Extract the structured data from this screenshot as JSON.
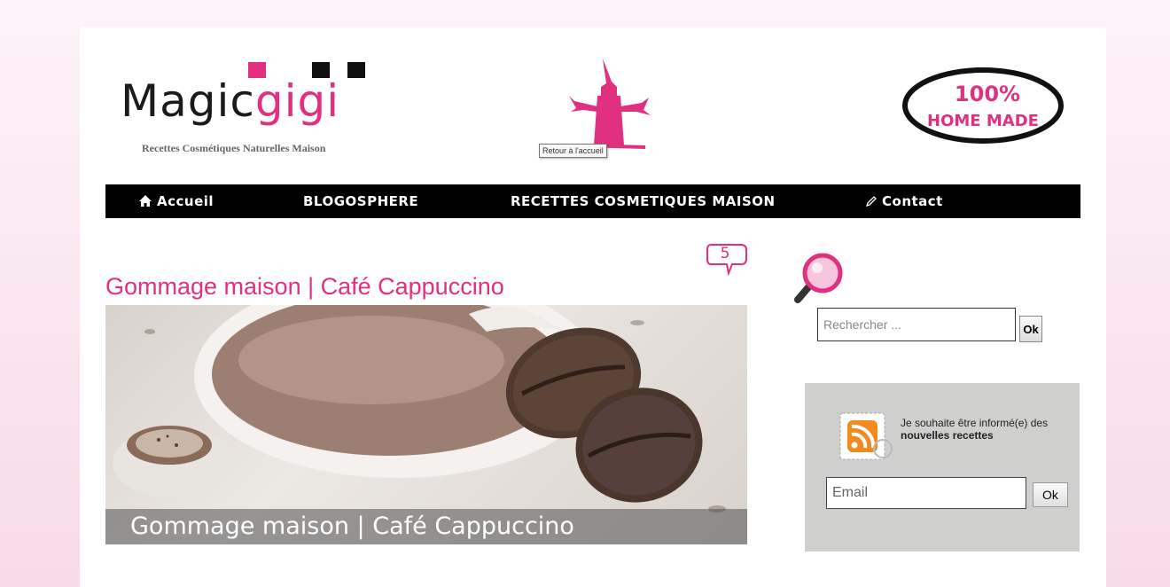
{
  "header": {
    "logo": {
      "part1": "Magic",
      "part2": "gigi",
      "tagline": "Recettes Cosmétiques Naturelles Maison"
    },
    "home_tooltip": "Retour à l'accueil",
    "badge": {
      "line1": "100%",
      "line2": "HOME MADE"
    }
  },
  "nav": {
    "items": [
      {
        "label": "Accueil",
        "icon": "home-icon"
      },
      {
        "label": "BLOGOSPHERE"
      },
      {
        "label": "RECETTES COSMETIQUES MAISON"
      },
      {
        "label": "Contact",
        "icon": "pencil-icon"
      }
    ]
  },
  "article": {
    "comment_count": "5",
    "title": "Gommage maison | Café Cappuccino",
    "image_caption": "Gommage maison | Café Cappuccino"
  },
  "sidebar": {
    "search": {
      "placeholder": "Rechercher ...",
      "button": "Ok"
    },
    "newsletter": {
      "text_plain": "Je souhaite être informé(e) des",
      "text_bold": "nouvelles recettes",
      "email_placeholder": "Email",
      "button": "Ok"
    }
  },
  "colors": {
    "accent": "#e0307f",
    "nav_bg": "#000000",
    "newsletter_bg": "#cfcfce"
  }
}
